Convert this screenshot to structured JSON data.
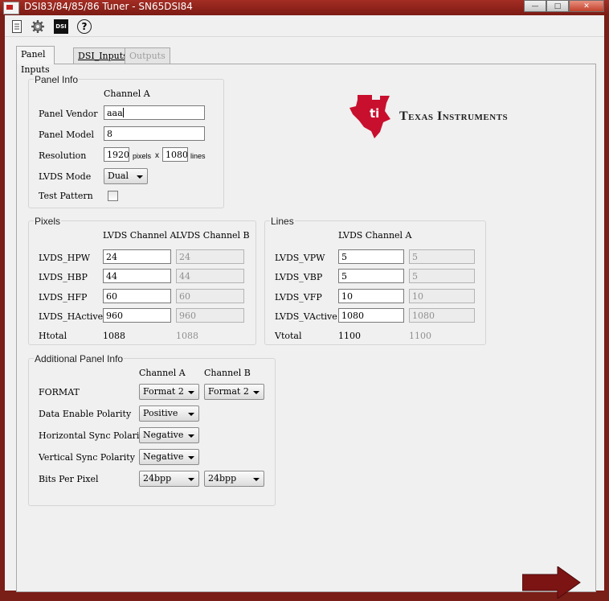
{
  "window": {
    "title": "DSI83/84/85/86 Tuner - SN65DSI84"
  },
  "toolbar": {
    "icons": [
      "document-icon",
      "gear-icon",
      "dsi-icon",
      "help-icon"
    ],
    "dsi_label": "DSI",
    "help_glyph": "?"
  },
  "tabs": [
    {
      "label": "Panel Inputs",
      "state": "active"
    },
    {
      "label": "DSI_Inputs",
      "state": "normal"
    },
    {
      "label": "Outputs",
      "state": "disabled"
    }
  ],
  "logo": {
    "brand": "Texas Instruments"
  },
  "panel_info": {
    "title": "Panel Info",
    "channel_header": "Channel A",
    "vendor_label": "Panel Vendor",
    "vendor_value": "aaa",
    "model_label": "Panel Model",
    "model_value": "8",
    "resolution_label": "Resolution",
    "res_width": "1920",
    "pixels_unit": "pixels",
    "times": "x",
    "res_height": "1080",
    "lines_unit": "lines",
    "lvds_mode_label": "LVDS Mode",
    "lvds_mode_value": "Dual",
    "test_pattern_label": "Test Pattern",
    "test_pattern_checked": false
  },
  "pixels": {
    "title": "Pixels",
    "header_a": "LVDS Channel A",
    "header_b": "LVDS Channel B",
    "rows": [
      {
        "label": "LVDS_HPW",
        "a": "24",
        "b": "24"
      },
      {
        "label": "LVDS_HBP",
        "a": "44",
        "b": "44"
      },
      {
        "label": "LVDS_HFP",
        "a": "60",
        "b": "60"
      },
      {
        "label": "LVDS_HActive",
        "a": "960",
        "b": "960"
      }
    ],
    "total_label": "Htotal",
    "total_a": "1088",
    "total_b": "1088"
  },
  "lines": {
    "title": "Lines",
    "header_a": "LVDS Channel A",
    "rows": [
      {
        "label": "LVDS_VPW",
        "a": "5",
        "b": "5"
      },
      {
        "label": "LVDS_VBP",
        "a": "5",
        "b": "5"
      },
      {
        "label": "LVDS_VFP",
        "a": "10",
        "b": "10"
      },
      {
        "label": "LVDS_VActive",
        "a": "1080",
        "b": "1080"
      }
    ],
    "total_label": "Vtotal",
    "total_a": "1100",
    "total_b": "1100"
  },
  "additional": {
    "title": "Additional Panel Info",
    "header_a": "Channel A",
    "header_b": "Channel B",
    "format_label": "FORMAT",
    "format_a": "Format 2",
    "format_b": "Format 2",
    "de_label": "Data Enable Polarity",
    "de_value": "Positive",
    "hsync_label": "Horizontal Sync Polarity",
    "hsync_value": "Negative",
    "vsync_label": "Vertical Sync Polarity",
    "vsync_value": "Negative",
    "bpp_label": "Bits Per Pixel",
    "bpp_a": "24bpp",
    "bpp_b": "24bpp"
  },
  "colors": {
    "ti_red": "#c8102e",
    "title_bar": "#a42d24",
    "next_arrow": "#7c1414"
  }
}
